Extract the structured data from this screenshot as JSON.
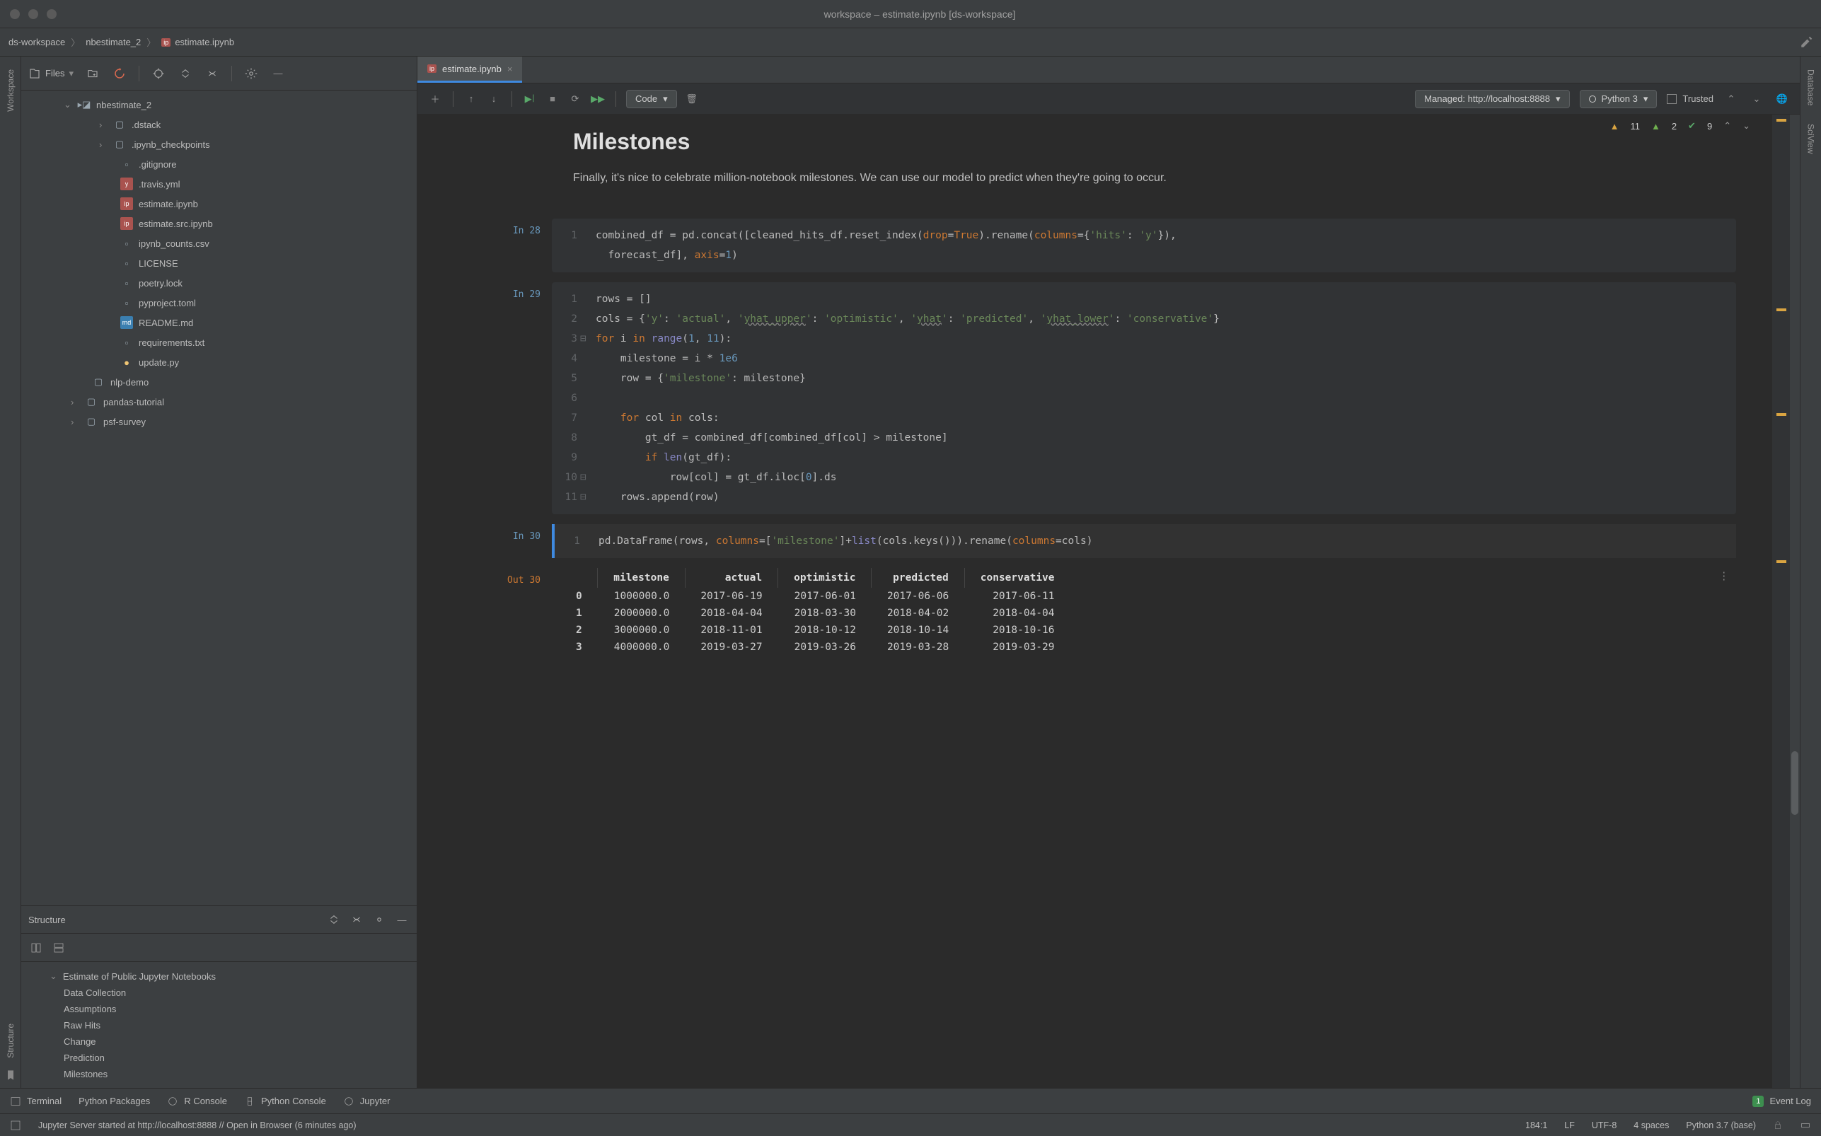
{
  "window": {
    "title": "workspace – estimate.ipynb [ds-workspace]"
  },
  "breadcrumb": {
    "a": "ds-workspace",
    "b": "nbestimate_2",
    "c": "estimate.ipynb"
  },
  "side_l": {
    "workspace": "Workspace",
    "structure": "Structure"
  },
  "side_r": {
    "database": "Database",
    "sciview": "SciView"
  },
  "files": {
    "label": "Files",
    "root": "nbestimate_2",
    "children": [
      {
        "name": ".dstack",
        "type": "dir"
      },
      {
        "name": ".ipynb_checkpoints",
        "type": "dir"
      },
      {
        "name": ".gitignore",
        "type": "file"
      },
      {
        "name": ".travis.yml",
        "type": "file"
      },
      {
        "name": "estimate.ipynb",
        "type": "nb"
      },
      {
        "name": "estimate.src.ipynb",
        "type": "nb"
      },
      {
        "name": "ipynb_counts.csv",
        "type": "file"
      },
      {
        "name": "LICENSE",
        "type": "file"
      },
      {
        "name": "poetry.lock",
        "type": "file"
      },
      {
        "name": "pyproject.toml",
        "type": "file"
      },
      {
        "name": "README.md",
        "type": "file"
      },
      {
        "name": "requirements.txt",
        "type": "file"
      },
      {
        "name": "update.py",
        "type": "file"
      }
    ],
    "siblings": [
      {
        "name": "nlp-demo",
        "type": "dir"
      },
      {
        "name": "pandas-tutorial",
        "type": "dir"
      },
      {
        "name": "psf-survey",
        "type": "dir"
      }
    ]
  },
  "structure": {
    "label": "Structure",
    "title": "Estimate of Public Jupyter Notebooks",
    "items": [
      "Data Collection",
      "Assumptions",
      "Raw Hits",
      "Change",
      "Prediction",
      "Milestones"
    ]
  },
  "tab": {
    "label": "estimate.ipynb"
  },
  "nb_toolbar": {
    "celltype": "Code",
    "managed": "Managed: http://localhost:8888",
    "kernel": "Python 3",
    "trusted": "Trusted"
  },
  "inspections": {
    "warn": "11",
    "weak": "2",
    "ok": "9"
  },
  "md": {
    "h": "Milestones",
    "p": "Finally, it's nice to celebrate million-notebook milestones. We can use our model to predict when they're going to occur."
  },
  "cells": {
    "c28": {
      "prompt": "In 28"
    },
    "c29": {
      "prompt": "In 29"
    },
    "c30": {
      "prompt": "In 30"
    },
    "o30": {
      "prompt": "Out 30"
    }
  },
  "out_table": {
    "headers": [
      "",
      "milestone",
      "actual",
      "optimistic",
      "predicted",
      "conservative"
    ],
    "rows": [
      [
        "0",
        "1000000.0",
        "2017-06-19",
        "2017-06-01",
        "2017-06-06",
        "2017-06-11"
      ],
      [
        "1",
        "2000000.0",
        "2018-04-04",
        "2018-03-30",
        "2018-04-02",
        "2018-04-04"
      ],
      [
        "2",
        "3000000.0",
        "2018-11-01",
        "2018-10-12",
        "2018-10-14",
        "2018-10-16"
      ],
      [
        "3",
        "4000000.0",
        "2019-03-27",
        "2019-03-26",
        "2019-03-28",
        "2019-03-29"
      ]
    ]
  },
  "bottom": {
    "terminal": "Terminal",
    "pypkg": "Python Packages",
    "rconsole": "R Console",
    "pyconsole": "Python Console",
    "jupyter": "Jupyter",
    "eventlog": "Event Log",
    "event_count": "1"
  },
  "status": {
    "msg": "Jupyter Server started at http://localhost:8888 // Open in Browser (6 minutes ago)",
    "pos": "184:1",
    "le": "LF",
    "enc": "UTF-8",
    "indent": "4 spaces",
    "py": "Python 3.7 (base)"
  }
}
